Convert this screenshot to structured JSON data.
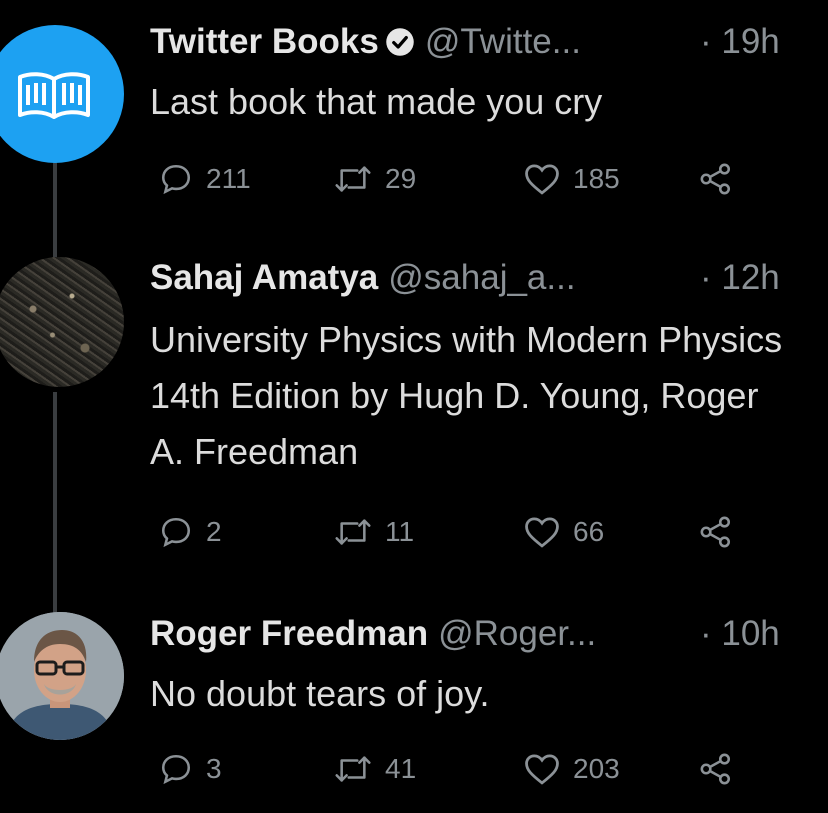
{
  "tweets": [
    {
      "name": "Twitter Books",
      "handle": "@Twitte...",
      "time": "· 19h",
      "text": "Last book that made you cry",
      "replies": "211",
      "retweets": "29",
      "likes": "185",
      "verified": true,
      "avatar": "book-logo-avatar"
    },
    {
      "name": "Sahaj Amatya",
      "handle": "@sahaj_a...",
      "time": "· 12h",
      "text": "University Physics with Modern Physics 14th Edition by Hugh D. Young, Roger A. Freedman",
      "replies": "2",
      "retweets": "11",
      "likes": "66",
      "avatar": "circuit-board-avatar"
    },
    {
      "name": "Roger Freedman",
      "handle": "@Roger...",
      "time": "· 10h",
      "text": "No doubt tears of joy.",
      "replies": "3",
      "retweets": "41",
      "likes": "203",
      "avatar": "man-with-glasses-avatar"
    }
  ],
  "colors": {
    "background": "#000000",
    "text": "#dcdcdc",
    "muted": "#8b9196",
    "accent": "#1da1f2",
    "thread_line": "#3a3d40"
  }
}
